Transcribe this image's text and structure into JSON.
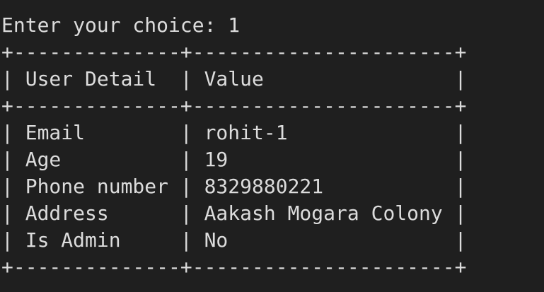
{
  "terminal": {
    "prompt_line": "Enter your choice: 1",
    "border_top": "+--------------+----------------------+",
    "header_row": "| User Detail  | Value                |",
    "border_mid": "+--------------+----------------------+",
    "rows": [
      "| Email        | rohit-1              |",
      "| Age          | 19                   |",
      "| Phone number | 8329880221           |",
      "| Address      | Aakash Mogara Colony |",
      "| Is Admin     | No                   |"
    ],
    "border_bottom": "+--------------+----------------------+"
  },
  "colors": {
    "background": "#1f1f1f",
    "text": "#dcdcdc"
  }
}
